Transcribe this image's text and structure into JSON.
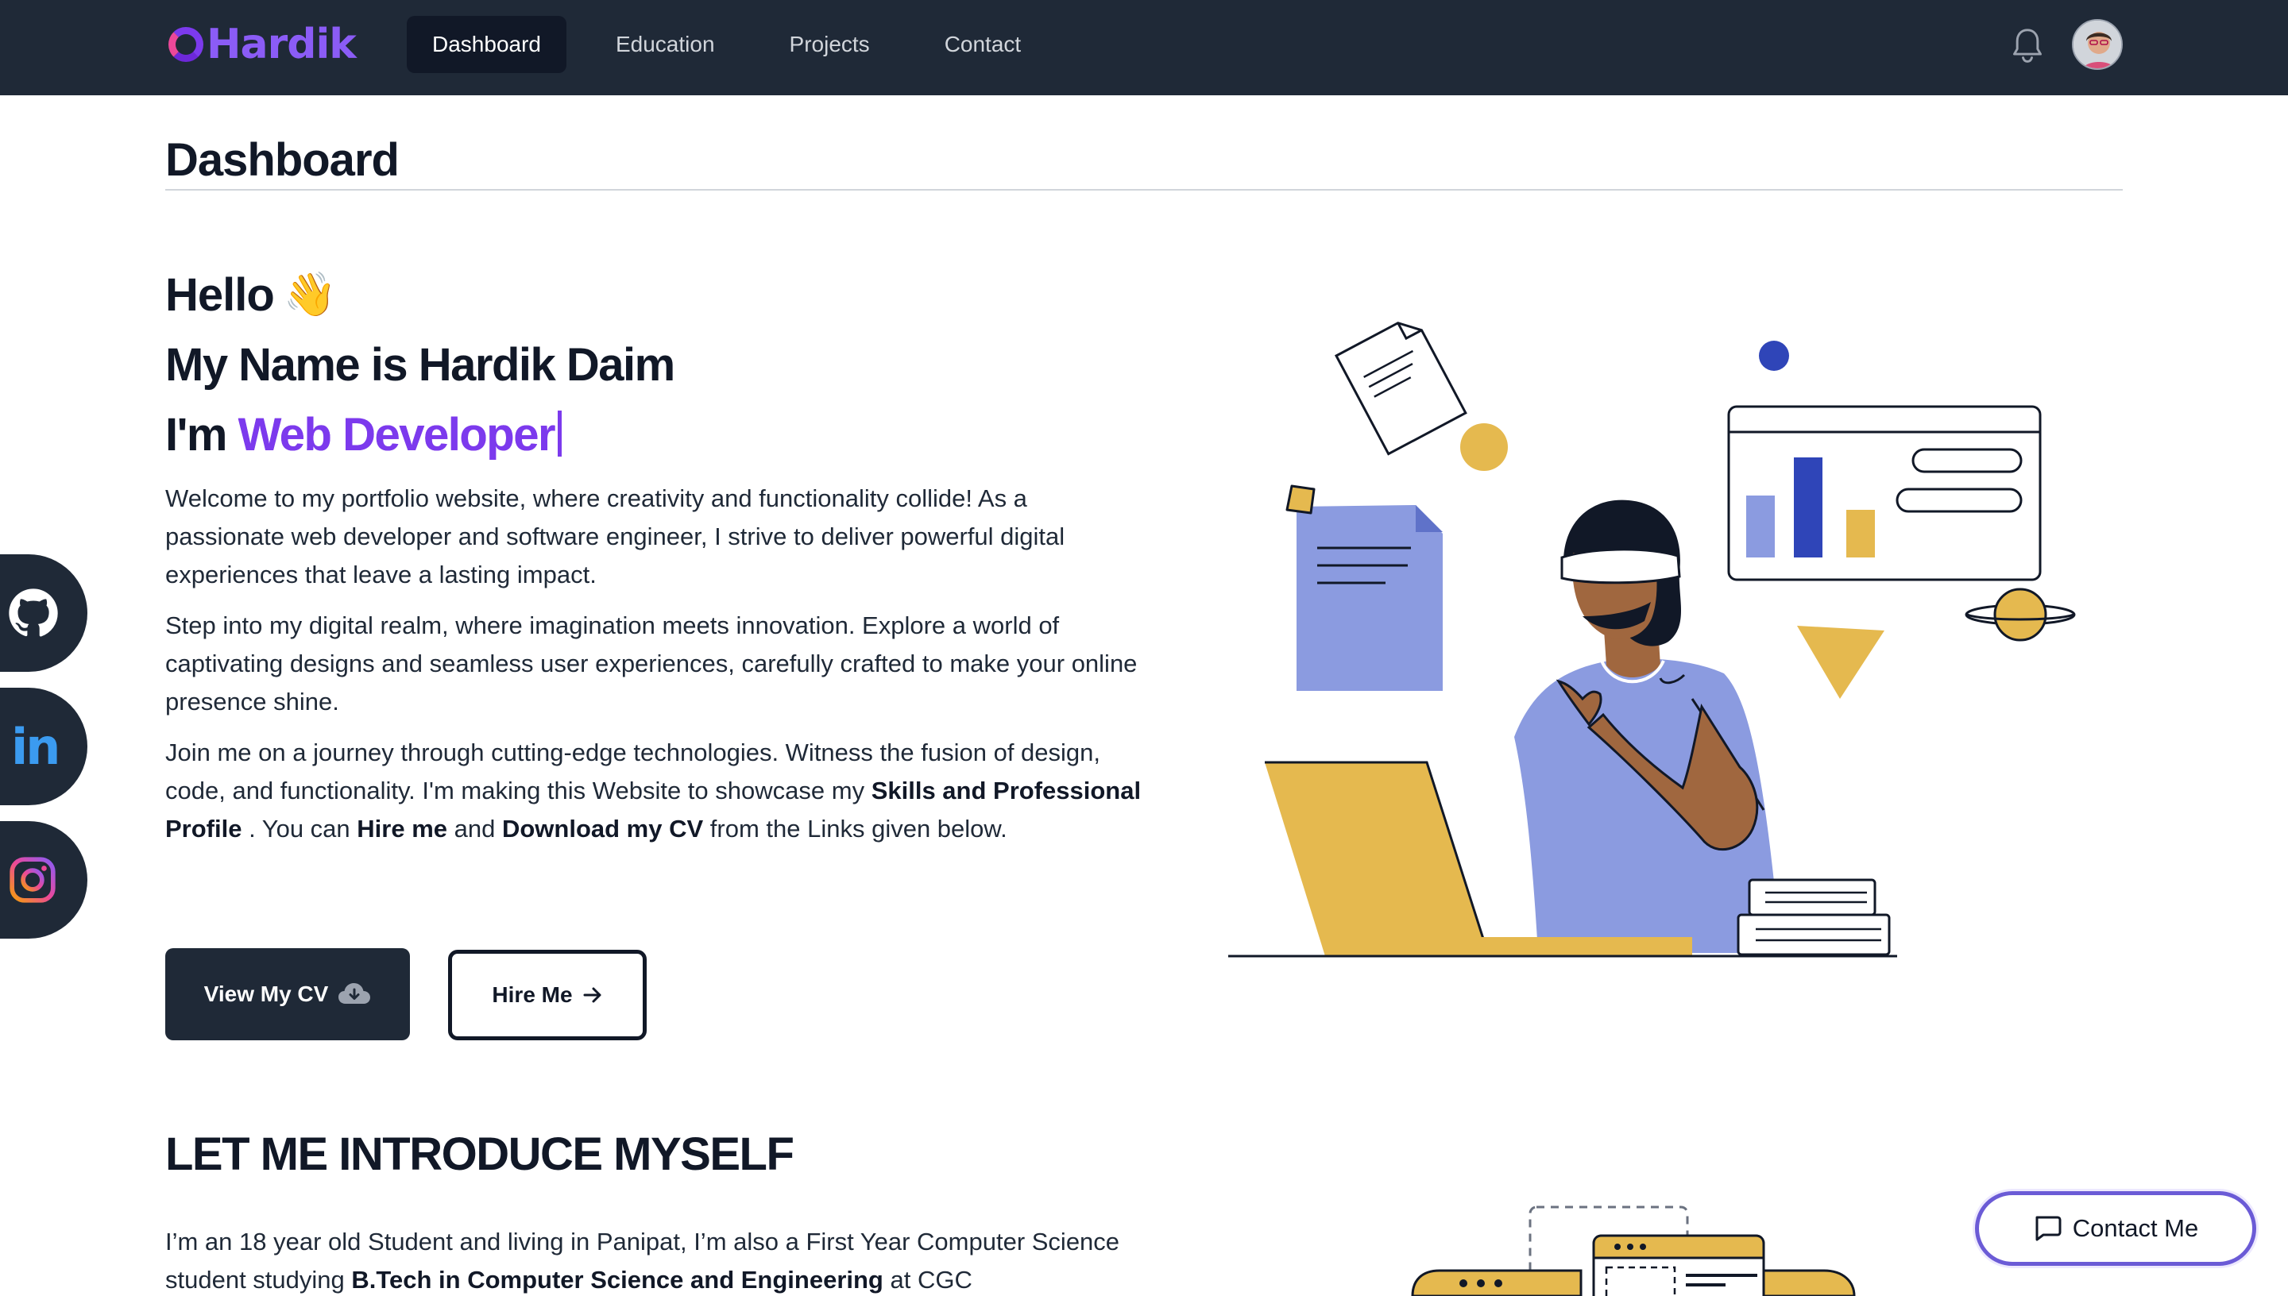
{
  "brand": {
    "name": "Hardik"
  },
  "nav": {
    "items": [
      {
        "label": "Dashboard",
        "active": true
      },
      {
        "label": "Education",
        "active": false
      },
      {
        "label": "Projects",
        "active": false
      },
      {
        "label": "Contact",
        "active": false
      }
    ],
    "icons": {
      "notifications": "bell-icon",
      "profile": "avatar"
    }
  },
  "page": {
    "title": "Dashboard"
  },
  "hero": {
    "hello": "Hello",
    "wave_emoji": "👋",
    "name_line": "My Name is Hardik Daim",
    "role_prefix": "I'm ",
    "role": "Web Developer",
    "para1": "Welcome to my portfolio website, where creativity and functionality collide! As a passionate web developer and software engineer, I strive to deliver powerful digital experiences that leave a lasting impact.",
    "para2": "Step into my digital realm, where imagination meets innovation. Explore a world of captivating designs and seamless user experiences, carefully crafted to make your online presence shine.",
    "para3": {
      "t1": "Join me on a journey through cutting-edge technologies. Witness the fusion of design, code, and functionality. I'm making this Website to showcase my ",
      "b1": "Skills and Professional Profile",
      "t2": " . You can ",
      "b2": "Hire me",
      "t3": " and ",
      "b3": "Download my CV",
      "t4": " from the Links given below."
    }
  },
  "buttons": {
    "cv": "View My CV",
    "hire": "Hire Me"
  },
  "intro": {
    "title": "LET ME INTRODUCE MYSELF",
    "t1": "I’m an 18 year old Student and living in Panipat, I’m also a First Year Computer Science student studying ",
    "b1": "B.Tech in Computer Science and Engineering",
    "t2": " at CGC"
  },
  "social": {
    "items": [
      "github-icon",
      "linkedin-icon",
      "instagram-icon"
    ],
    "linkedin_text": "in"
  },
  "contact_float": {
    "label": "Contact Me"
  },
  "colors": {
    "navbar": "#1f2937",
    "accent": "#7c3aed",
    "illustration_blue": "#8b9be0",
    "illustration_yellow": "#e5b94f",
    "illustration_navy": "#2f45b8",
    "skin": "#a0673f"
  }
}
